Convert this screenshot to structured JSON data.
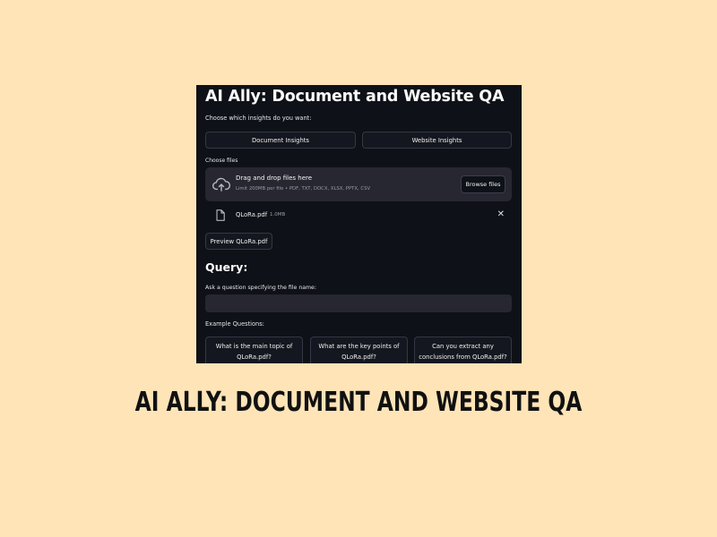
{
  "app": {
    "title": "AI Ally: Document and Website QA",
    "insights_prompt": "Choose which insights do you want:",
    "insight_buttons": {
      "document": "Document Insights",
      "website": "Website Insights"
    },
    "files_label": "Choose files",
    "uploader": {
      "drag_text": "Drag and drop files here",
      "limit_text": "Limit 200MB per file • PDF, TXT, DOCX, XLSX, PPTX, CSV",
      "browse_label": "Browse files",
      "upload_icon": "cloud-upload-icon"
    },
    "uploaded_file": {
      "name": "QLoRa.pdf",
      "size": "1.0MB",
      "icon": "file-icon",
      "remove_icon": "close-icon",
      "remove_glyph": "✕"
    },
    "preview_button": "Preview QLoRa.pdf",
    "query": {
      "heading": "Query:",
      "prompt": "Ask a question specifying the file name:",
      "value": ""
    },
    "examples": {
      "label": "Example Questions:",
      "questions": [
        {
          "line1": "What is the main topic of",
          "line2": "QLoRa.pdf?"
        },
        {
          "line1": "What are the key points of",
          "line2": "QLoRa.pdf?"
        },
        {
          "line1": "Can you extract any",
          "line2": "conclusions from QLoRa.pdf?"
        }
      ]
    }
  },
  "caption": "AI Ally: Document and Website QA",
  "colors": {
    "page_background": "#ffe4b8",
    "app_background": "#0e1117",
    "panel_background": "#262730",
    "text": "#fafafa"
  }
}
